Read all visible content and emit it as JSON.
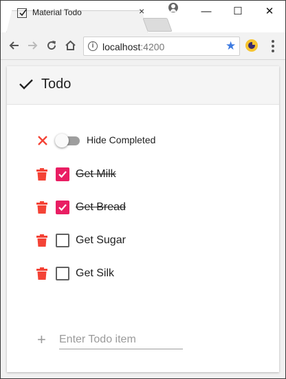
{
  "browser": {
    "tab_title": "Material Todo",
    "tab_close_glyph": "×",
    "url_host": "localhost",
    "url_port": ":4200",
    "window_buttons": {
      "minimize": "—",
      "maximize": "☐",
      "close": "✕"
    }
  },
  "app": {
    "title": "Todo",
    "hide_completed_label": "Hide Completed",
    "hide_completed_on": false,
    "add_placeholder": "Enter Todo item",
    "accent_color": "#e91e63",
    "delete_color": "#f44336"
  },
  "todos": [
    {
      "text": "Get Milk",
      "done": true
    },
    {
      "text": "Get Bread",
      "done": true
    },
    {
      "text": "Get Sugar",
      "done": false
    },
    {
      "text": "Get Silk",
      "done": false
    }
  ],
  "icons": {
    "tab_favicon": "checkbox-icon",
    "back": "arrow-left-icon",
    "forward": "arrow-right-icon",
    "reload": "reload-icon",
    "home": "home-icon",
    "info": "info-icon",
    "bookmark": "star-icon",
    "extension": "extension-icon",
    "menu": "vertical-dots-icon",
    "header": "check-icon",
    "clear_completed": "close-icon",
    "delete": "trash-icon",
    "add": "plus-icon"
  }
}
